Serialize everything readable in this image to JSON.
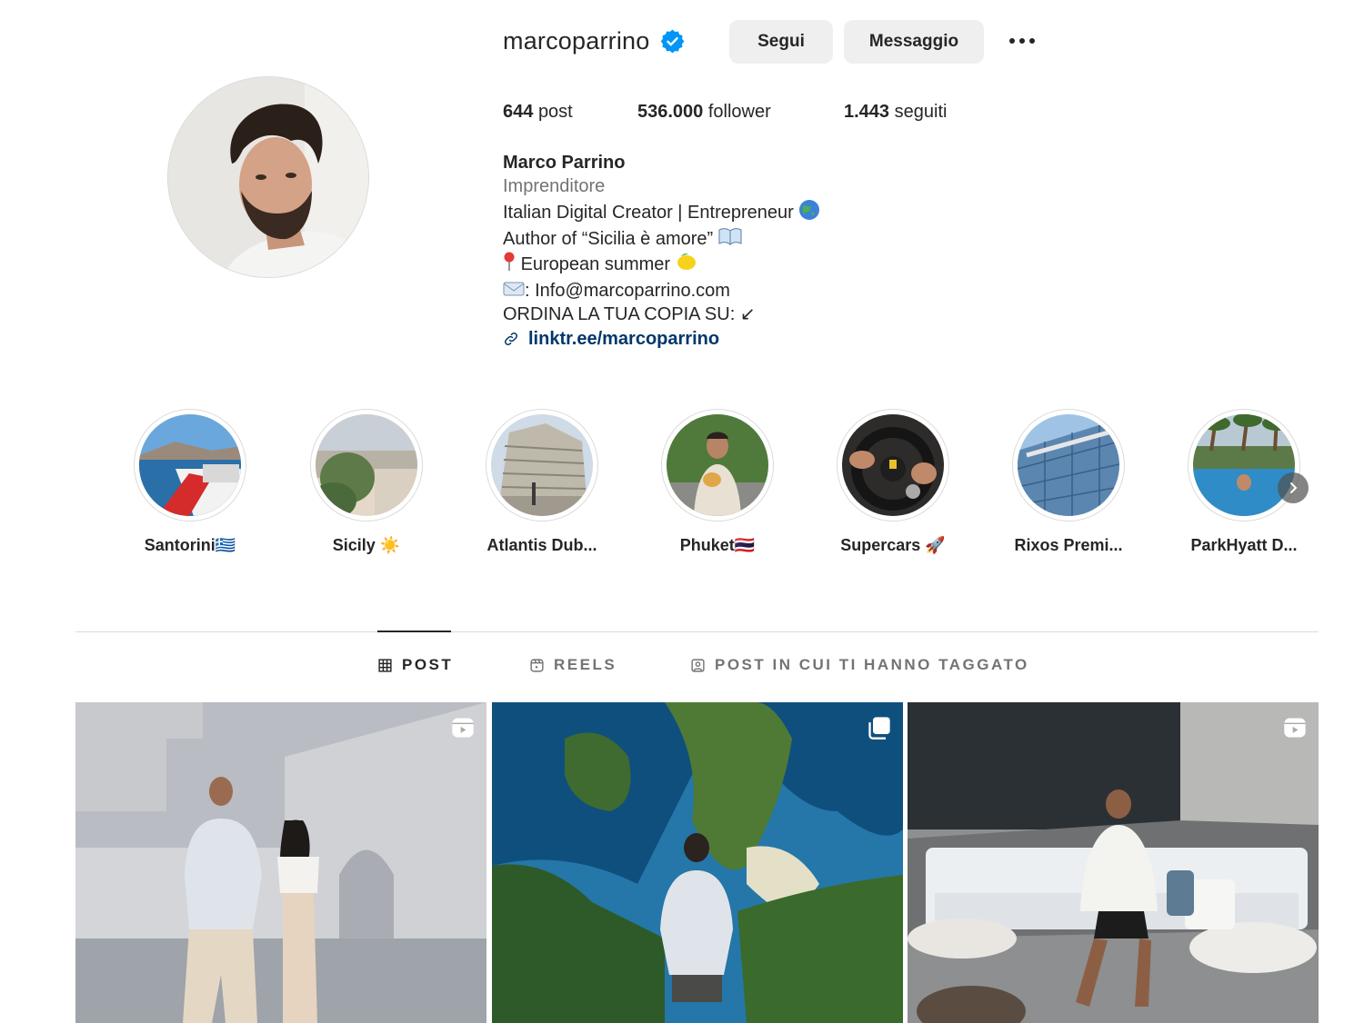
{
  "profile": {
    "username": "marcoparrino",
    "verified": true,
    "follow_label": "Segui",
    "message_label": "Messaggio",
    "more_icon": "more-horizontal-icon",
    "stats": {
      "posts": "644",
      "posts_label": "post",
      "followers": "536.000",
      "followers_label": "follower",
      "following": "1.443",
      "following_label": "seguiti"
    },
    "full_name": "Marco Parrino",
    "category": "Imprenditore",
    "bio_lines": [
      "Italian Digital Creator | Entrepreneur",
      "Author of “Sicilia è amore”",
      "European summer",
      ": Info@marcoparrino.com",
      "ORDINA LA TUA COPIA SU: ↙"
    ],
    "link": "linktr.ee/marcoparrino"
  },
  "highlights": [
    {
      "label": "Santorini🇬🇷"
    },
    {
      "label": "Sicily ☀️"
    },
    {
      "label": "Atlantis Dub..."
    },
    {
      "label": "Phuket🇹🇭"
    },
    {
      "label": "Supercars 🚀"
    },
    {
      "label": "Rixos Premi..."
    },
    {
      "label": "ParkHyatt D..."
    }
  ],
  "tabs": [
    {
      "label": "POST",
      "icon": "grid-icon",
      "active": true
    },
    {
      "label": "REELS",
      "icon": "reels-icon",
      "active": false
    },
    {
      "label": "POST IN CUI TI HANNO TAGGATO",
      "icon": "tagged-icon",
      "active": false
    }
  ],
  "posts": [
    {
      "type": "reel",
      "badge_icon": "reel-badge-icon"
    },
    {
      "type": "carousel",
      "badge_icon": "carousel-badge-icon"
    },
    {
      "type": "reel",
      "badge_icon": "reel-badge-icon"
    }
  ],
  "colors": {
    "text": "#262626",
    "secondary": "#737373",
    "link": "#00376b",
    "button_bg": "#efefef",
    "verified_blue": "#0095f6",
    "border": "#dbdbdb"
  }
}
